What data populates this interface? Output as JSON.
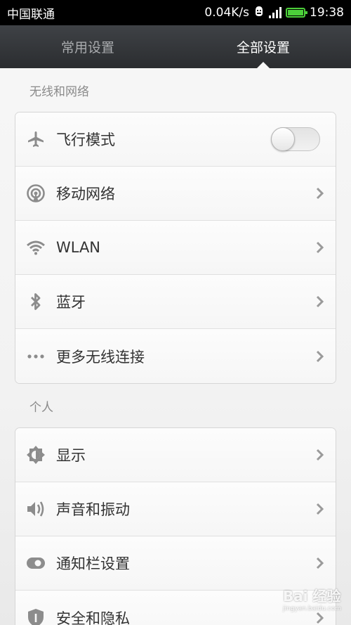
{
  "status_bar": {
    "carrier": "中国联通",
    "speed": "0.04K/s",
    "time": "19:38"
  },
  "tabs": [
    {
      "label": "常用设置",
      "active": false
    },
    {
      "label": "全部设置",
      "active": true
    }
  ],
  "sections": [
    {
      "header": "无线和网络",
      "items": [
        {
          "label": "飞行模式",
          "icon": "airplane-icon",
          "control": "toggle",
          "value": false
        },
        {
          "label": "移动网络",
          "icon": "mobile-network-icon",
          "control": "chevron"
        },
        {
          "label": "WLAN",
          "icon": "wifi-icon",
          "control": "chevron"
        },
        {
          "label": "蓝牙",
          "icon": "bluetooth-icon",
          "control": "chevron"
        },
        {
          "label": "更多无线连接",
          "icon": "more-dots-icon",
          "control": "chevron"
        }
      ]
    },
    {
      "header": "个人",
      "items": [
        {
          "label": "显示",
          "icon": "brightness-icon",
          "control": "chevron"
        },
        {
          "label": "声音和振动",
          "icon": "speaker-icon",
          "control": "chevron"
        },
        {
          "label": "通知栏设置",
          "icon": "notification-toggle-icon",
          "control": "chevron"
        },
        {
          "label": "安全和隐私",
          "icon": "shield-icon",
          "control": "chevron"
        }
      ]
    }
  ],
  "watermark": {
    "brand": "Bai 经验",
    "url": "jingyan.baidu.com"
  },
  "colors": {
    "battery": "#4ccf3a",
    "tab_bar": "#2b2d30",
    "icon_gray": "#8c8c8c"
  }
}
